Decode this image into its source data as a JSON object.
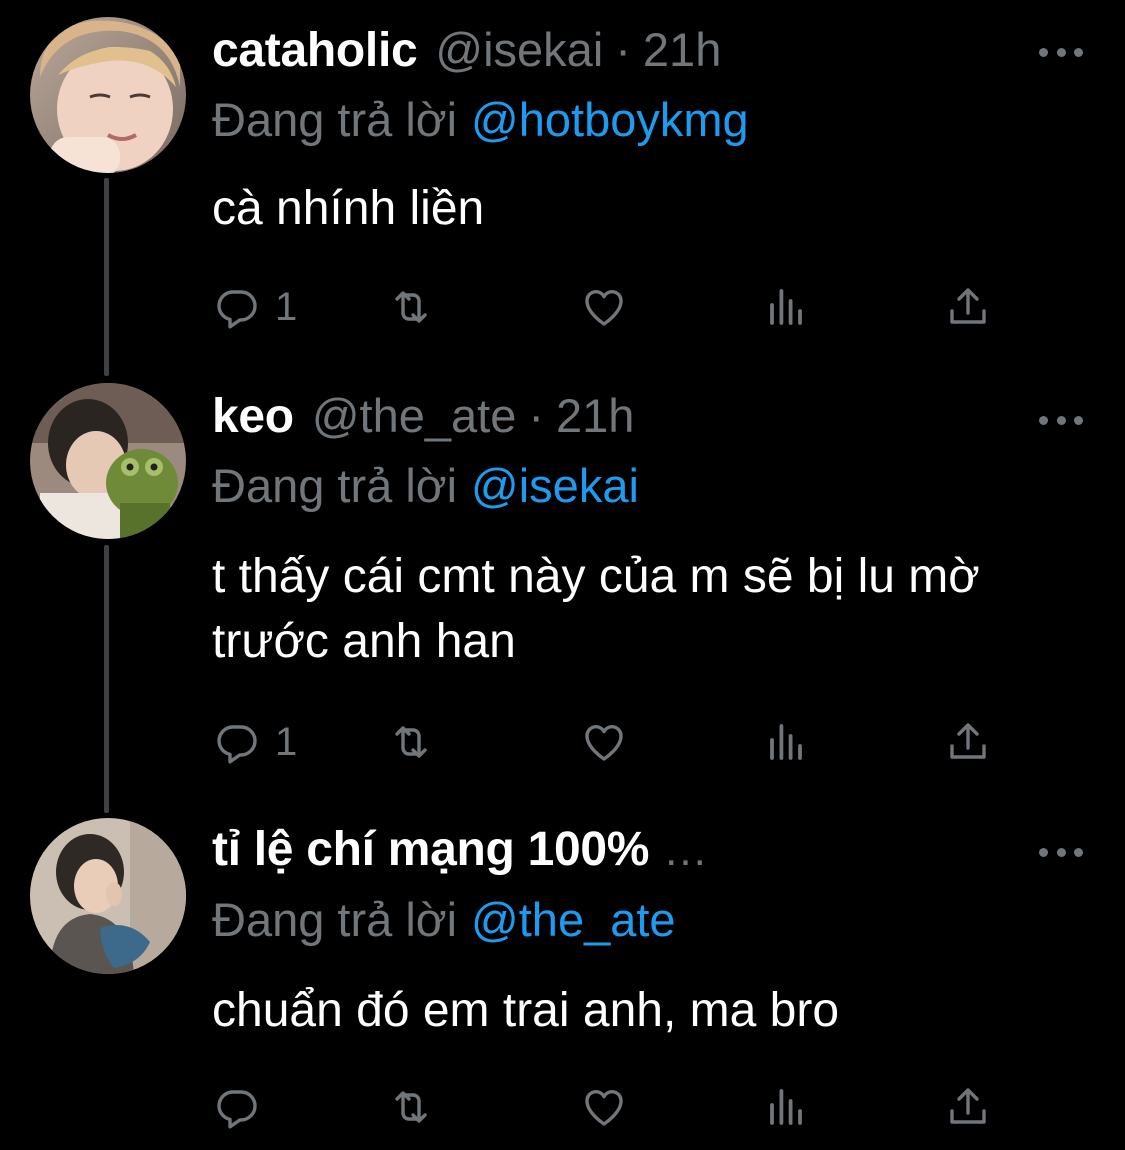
{
  "reply_prefix": "Đang trả lời",
  "colors": {
    "background": "#000000",
    "text": "#ffffff",
    "muted": "#71767b",
    "mention": "#1d9bf0",
    "thread_line": "#3e4144"
  },
  "tweets": [
    {
      "display_name": "cataholic",
      "handle": "@isekai",
      "separator": "·",
      "time": "21h",
      "replying_to": "@hotboykmg",
      "text": "cà nhính liền",
      "reply_count": "1",
      "icons": [
        "reply-icon",
        "retweet-icon",
        "like-icon",
        "views-icon",
        "share-icon",
        "more-icon"
      ]
    },
    {
      "display_name": "keo",
      "handle": "@the_ate",
      "separator": "·",
      "time": "21h",
      "replying_to": "@isekai",
      "text": "t thấy cái cmt này của m sẽ bị lu mờ trước anh han",
      "reply_count": "1",
      "icons": [
        "reply-icon",
        "retweet-icon",
        "like-icon",
        "views-icon",
        "share-icon",
        "more-icon"
      ]
    },
    {
      "display_name": "tỉ lệ chí mạng 100%",
      "truncation": "...",
      "replying_to": "@the_ate",
      "text": "chuẩn đó em trai anh, ma bro",
      "reply_count": "",
      "icons": [
        "reply-icon",
        "retweet-icon",
        "like-icon",
        "views-icon",
        "share-icon",
        "more-icon"
      ]
    }
  ]
}
